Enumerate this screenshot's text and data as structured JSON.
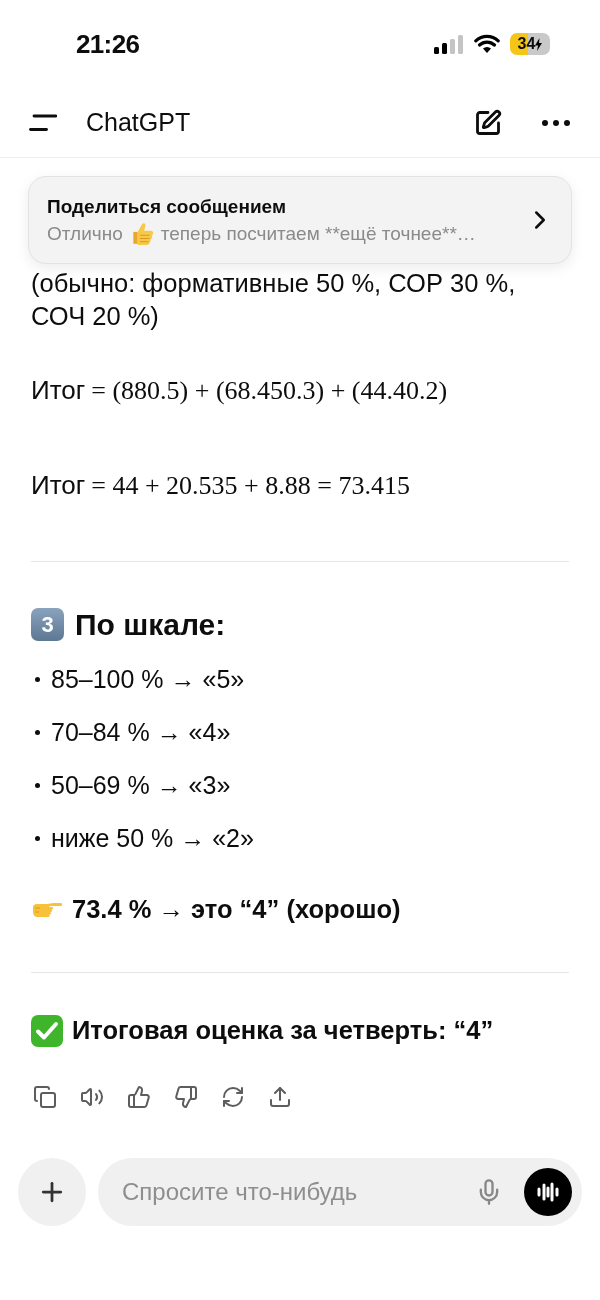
{
  "status_bar": {
    "time": "21:26",
    "battery_percent": "34"
  },
  "header": {
    "title": "ChatGPT"
  },
  "share_banner": {
    "title": "Поделиться сообщением",
    "preview_start": "Отлично",
    "preview_end": "теперь посчитаем **ещё точнее**…"
  },
  "message": {
    "partial_paragraph": "(обычно: формативные 50 %, СОР 30 %, СОЧ 20 %)",
    "equations": [
      {
        "label": "Итог",
        "math": "= (880.5) + (68.450.3) + (44.40.2)"
      },
      {
        "label": "Итог",
        "math": "= 44 + 20.535 + 8.88 = 73.415"
      }
    ],
    "section": {
      "number": "3",
      "title": "По шкале:",
      "bullets": [
        "85–100 % → «5»",
        "70–84 % → «4»",
        "50–69 % → «3»",
        "ниже 50 % → «2»"
      ]
    },
    "conclusion": "73.4 % → это “4” (хорошо)",
    "final": "Итоговая оценка за четверть: “4”"
  },
  "composer": {
    "placeholder": "Спросите что-нибудь"
  }
}
